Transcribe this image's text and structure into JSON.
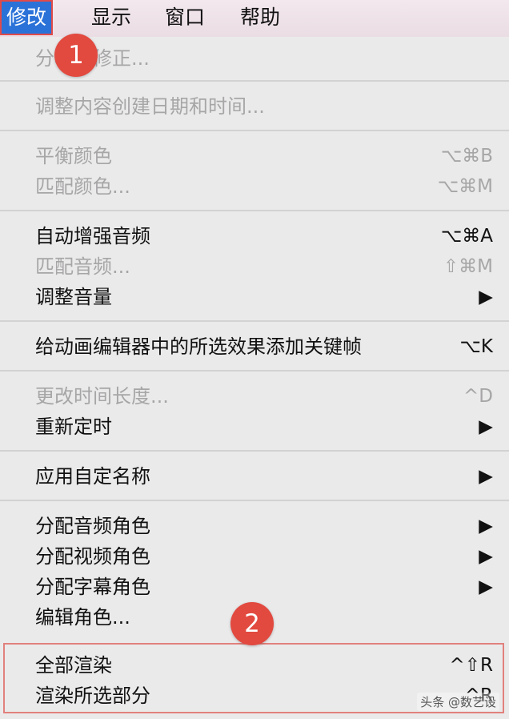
{
  "menubar": {
    "items": [
      {
        "label": "修改"
      },
      {
        "label": "显示"
      },
      {
        "label": "窗口"
      },
      {
        "label": "帮助"
      }
    ]
  },
  "menu": {
    "items": [
      {
        "label": "分析并修正...",
        "shortcut": "",
        "disabled": true
      },
      {
        "label": "调整内容创建日期和时间...",
        "shortcut": "",
        "disabled": true
      },
      {
        "label": "平衡颜色",
        "shortcut": "⌥⌘B",
        "disabled": true
      },
      {
        "label": "匹配颜色...",
        "shortcut": "⌥⌘M",
        "disabled": true
      },
      {
        "label": "自动增强音频",
        "shortcut": "⌥⌘A",
        "disabled": false
      },
      {
        "label": "匹配音频...",
        "shortcut": "⇧⌘M",
        "disabled": true
      },
      {
        "label": "调整音量",
        "shortcut": "▶",
        "disabled": false
      },
      {
        "label": "给动画编辑器中的所选效果添加关键帧",
        "shortcut": "⌥K",
        "disabled": false
      },
      {
        "label": "更改时间长度...",
        "shortcut": "^D",
        "disabled": true
      },
      {
        "label": "重新定时",
        "shortcut": "▶",
        "disabled": false
      },
      {
        "label": "应用自定名称",
        "shortcut": "▶",
        "disabled": false
      },
      {
        "label": "分配音频角色",
        "shortcut": "▶",
        "disabled": false
      },
      {
        "label": "分配视频角色",
        "shortcut": "▶",
        "disabled": false
      },
      {
        "label": "分配字幕角色",
        "shortcut": "▶",
        "disabled": false
      },
      {
        "label": "编辑角色...",
        "shortcut": "",
        "disabled": false
      },
      {
        "label": "全部渲染",
        "shortcut": "^⇧R",
        "disabled": false
      },
      {
        "label": "渲染所选部分",
        "shortcut": "^R",
        "disabled": false
      }
    ]
  },
  "annotations": {
    "badge1": "1",
    "badge2": "2"
  },
  "watermark": "头条 @数艺设"
}
